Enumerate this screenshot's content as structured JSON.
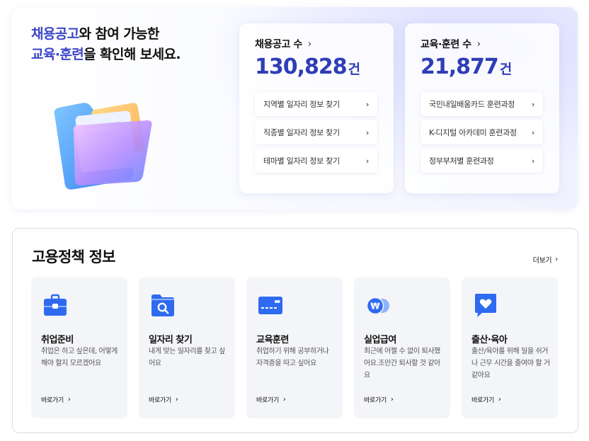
{
  "hero": {
    "title_line1_accent": "채용공고",
    "title_line1_rest": "와 참여 가능한",
    "title_line2_accent": "교육·훈련",
    "title_line2_rest": "을 확인해 보세요."
  },
  "jobs": {
    "label": "채용공고 수",
    "count": "130,828",
    "unit": "건",
    "links": [
      "지역별 일자리 정보 찾기",
      "직종별 일자리 정보 찾기",
      "테마별 일자리 정보 찾기"
    ]
  },
  "training": {
    "label": "교육·훈련 수",
    "count": "21,877",
    "unit": "건",
    "links": [
      "국민내일배움카드 훈련과정",
      "K-디지털 아카데미 훈련과정",
      "정부부처별 훈련과정"
    ]
  },
  "policy": {
    "title": "고용정책 정보",
    "more_label": "더보기",
    "go_label": "바로가기",
    "cards": [
      {
        "title": "취업준비",
        "desc": "취업은 하고 싶은데, 어떻게 해야 할지 모르겠어요",
        "icon": "briefcase-icon"
      },
      {
        "title": "일자리 찾기",
        "desc": "내게 맞는 일자리를 찾고 싶어요",
        "icon": "folder-search-icon"
      },
      {
        "title": "교육훈련",
        "desc": "취업하기 위해 공부하거나 자격증을 따고 싶어요",
        "icon": "card-icon"
      },
      {
        "title": "실업급여",
        "desc": "최근에 어쩔 수 없이 퇴사했어요.조만간 퇴사할 것 같아요",
        "icon": "won-coin-icon"
      },
      {
        "title": "출산·육아",
        "desc": "출산/육아를 위해 일을 쉬거나 근무 시간을 줄여야 할 거 같아요",
        "icon": "heart-chat-icon"
      }
    ]
  },
  "colors": {
    "accent": "#3b46c7",
    "number": "#2f3db7",
    "icon_blue": "#2f6bf0"
  }
}
